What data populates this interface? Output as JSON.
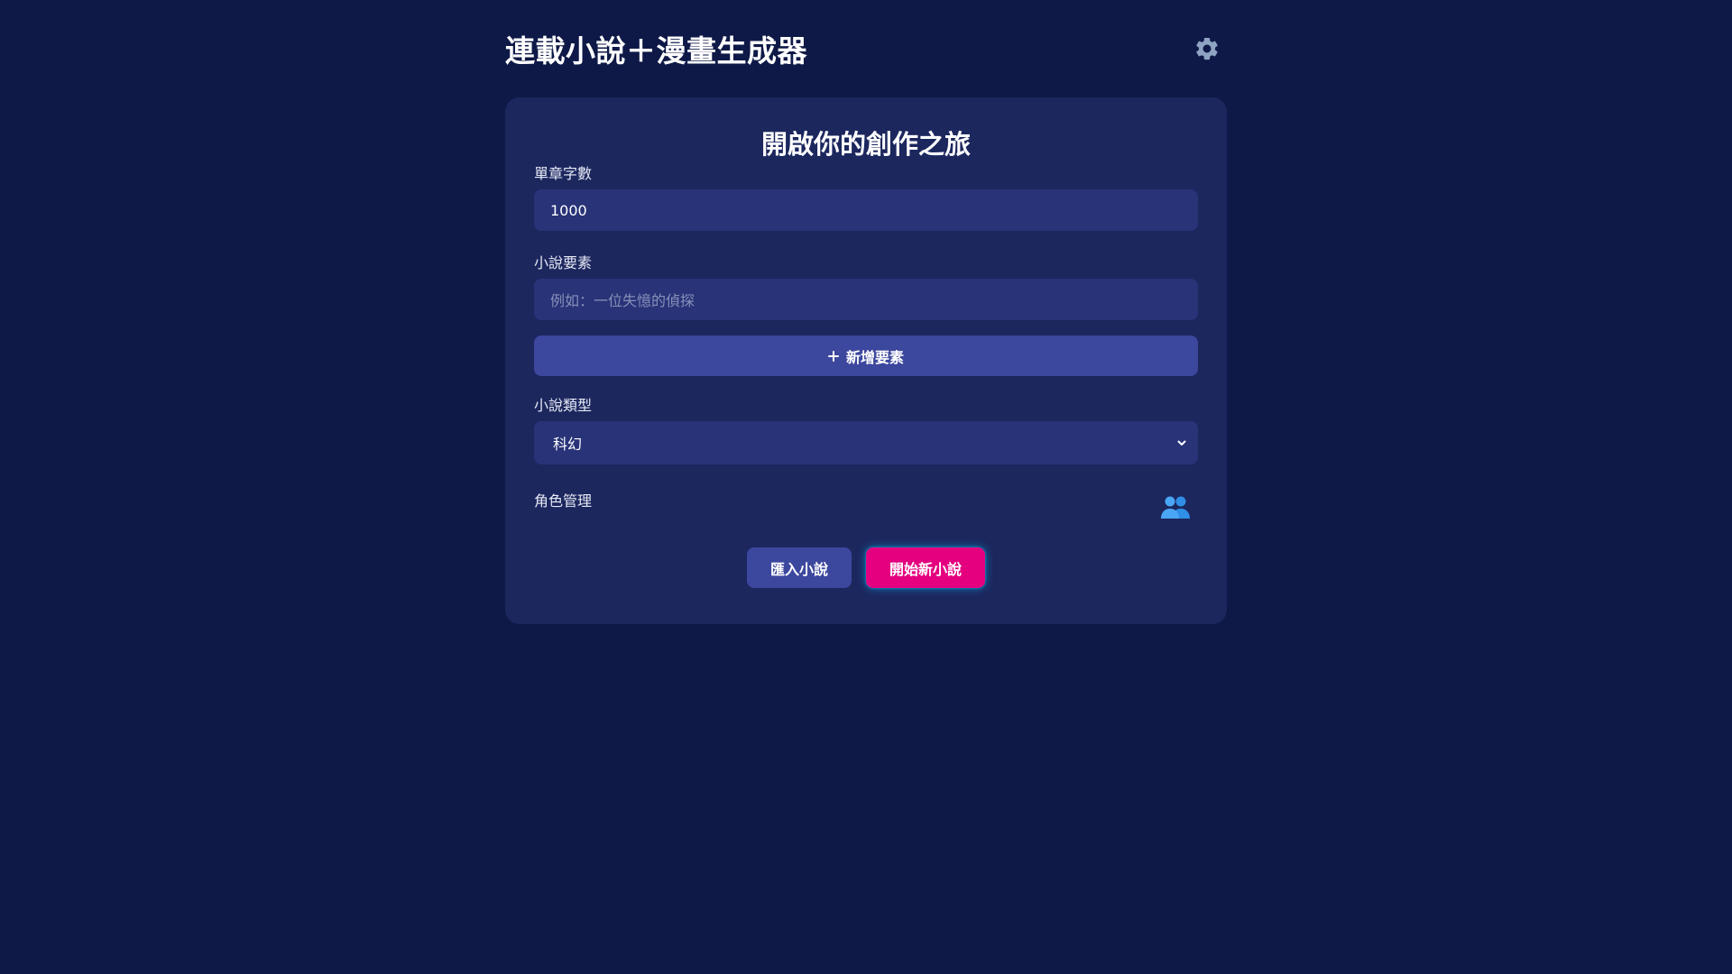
{
  "header": {
    "title": "連載小說＋漫畫生成器",
    "settings_icon": "gear-icon"
  },
  "card": {
    "title": "開啟你的創作之旅",
    "word_count": {
      "label": "單章字數",
      "value": "1000"
    },
    "elements": {
      "label": "小說要素",
      "placeholder": "例如：一位失憶的偵探",
      "add_button": "新增要素",
      "add_icon": "plus-icon"
    },
    "genre": {
      "label": "小說類型",
      "selected": "科幻",
      "chevron_icon": "chevron-down-icon"
    },
    "characters": {
      "label": "角色管理",
      "icon": "people-icon"
    },
    "actions": {
      "import_label": "匯入小說",
      "start_label": "開始新小說"
    }
  },
  "colors": {
    "background": "#0e1947",
    "card": "#1c275e",
    "input": "#283378",
    "button": "#3c479e",
    "accent": "#e4007e"
  }
}
